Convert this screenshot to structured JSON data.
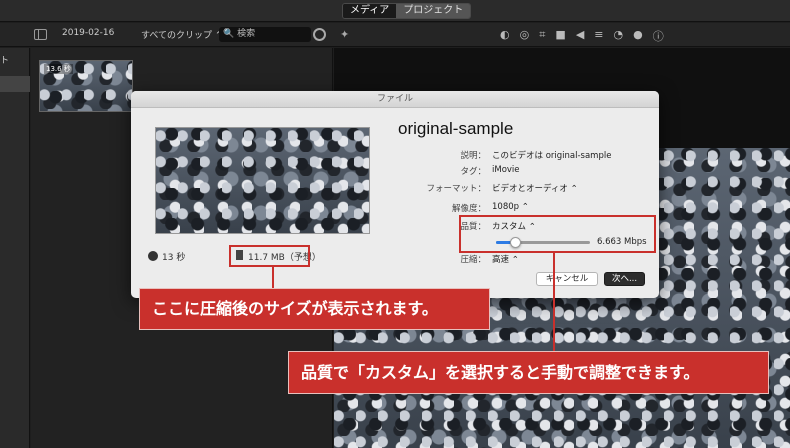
{
  "tabs": {
    "media": "メディア",
    "project": "プロジェクト"
  },
  "toolbar": {
    "date": "2019-02-16",
    "clip_filter": "すべてのクリップ ⌃",
    "search_placeholder": "🔍 検索"
  },
  "sidebar": {
    "label": "ト"
  },
  "browser": {
    "clip_duration": "13.6 秒"
  },
  "dialog": {
    "title": "ファイル",
    "heading": "original-sample",
    "duration": "13 秒",
    "file_size": "11.7 MB（予想）",
    "fields": {
      "description_label": "説明：",
      "description_value": "このビデオは original-sample",
      "tags_label": "タグ：",
      "tags_value": "iMovie",
      "format_label": "フォーマット：",
      "format_value": "ビデオとオーディオ ⌃",
      "resolution_label": "解像度：",
      "resolution_value": "1080p ⌃",
      "quality_label": "品質：",
      "quality_value": "カスタム ⌃",
      "bitrate": "6.663 Mbps",
      "compress_label": "圧縮：",
      "compress_value": "高速 ⌃"
    },
    "slider_level": 0.2,
    "cancel_label": "キャンセル",
    "next_label": "次へ..."
  },
  "callouts": {
    "size_note": "ここに圧縮後のサイズが表示されます。",
    "quality_note": "品質で「カスタム」を選択すると手動で調整できます。"
  },
  "colors": {
    "accent_red": "#c9302c",
    "slider_blue": "#2c7be5"
  }
}
